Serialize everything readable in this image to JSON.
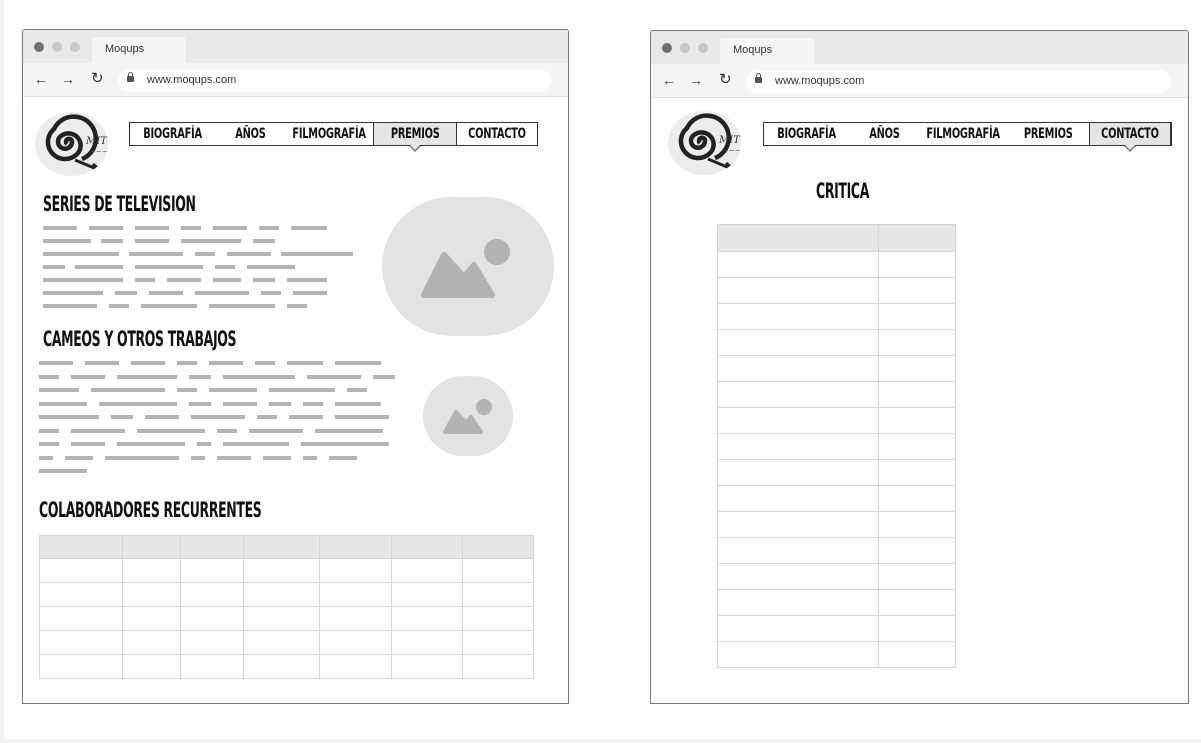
{
  "browser": {
    "tab_title": "Moqups",
    "url": "www.moqups.com",
    "back_icon": "arrow-left-icon",
    "forward_icon": "arrow-right-icon",
    "reload_icon": "reload-icon"
  },
  "logo": {
    "text": "MIT",
    "icon": "spiral-logo"
  },
  "nav": {
    "items": [
      "BIOGRAFÍA",
      "AÑOS",
      "FILMOGRAFÍA",
      "PREMIOS",
      "CONTACTO"
    ]
  },
  "left_page": {
    "active_nav": "PREMIOS",
    "section1_title": "SERIES DE TELEVISION",
    "section2_title": "CAMEOS Y OTROS TRABAJOS",
    "section3_title": "COLABORADORES RECURRENTES",
    "table": {
      "columns": 7,
      "rows": 5,
      "has_header": true
    }
  },
  "right_page": {
    "active_nav": "CONTACTO",
    "title": "CRITICA",
    "table": {
      "columns": 2,
      "rows": 16,
      "has_header": true
    }
  }
}
